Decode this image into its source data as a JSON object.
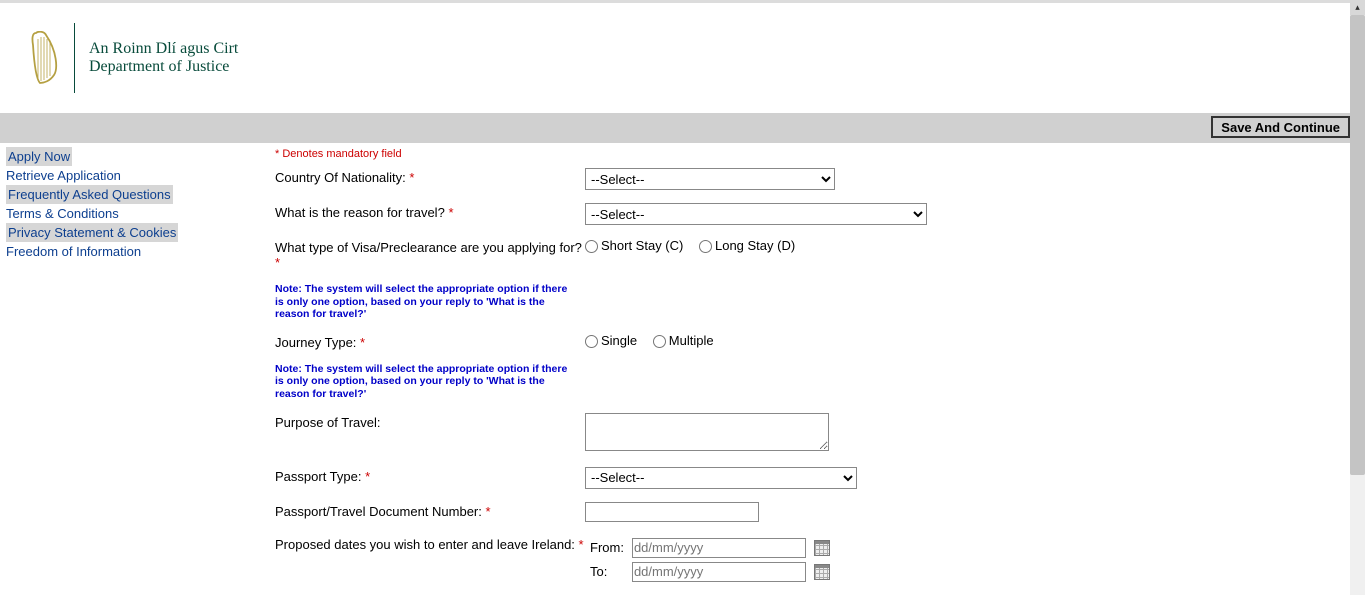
{
  "logo": {
    "line1": "An Roinn Dlí agus Cirt",
    "line2": "Department of Justice"
  },
  "save_button": "Save And Continue",
  "sidebar": {
    "items": [
      {
        "label": "Apply Now",
        "highlight": true
      },
      {
        "label": "Retrieve Application",
        "highlight": false
      },
      {
        "label": "Frequently Asked Questions",
        "highlight": true
      },
      {
        "label": "Terms & Conditions",
        "highlight": false
      },
      {
        "label": "Privacy Statement & Cookies",
        "highlight": true
      },
      {
        "label": "Freedom of Information",
        "highlight": false
      }
    ]
  },
  "mandatory_note": "* Denotes mandatory field",
  "select_placeholder": "--Select--",
  "labels": {
    "nationality": "Country Of Nationality:",
    "reason": "What is the reason for travel?",
    "visa_type": "What type of Visa/Preclearance are you applying for?",
    "journey_type": "Journey Type:",
    "purpose": "Purpose of Travel:",
    "passport_type": "Passport Type:",
    "doc_number": "Passport/Travel Document Number:",
    "proposed_dates": "Proposed dates you wish to enter and leave Ireland:",
    "from": "From:",
    "to": "To:"
  },
  "radios": {
    "short_stay": "Short Stay (C)",
    "long_stay": "Long Stay (D)",
    "single": "Single",
    "multiple": "Multiple"
  },
  "date_placeholder": "dd/mm/yyyy",
  "note_text": "Note: The system will select the appropriate option if there is only one option, based on your reply to 'What is the reason for travel?'"
}
